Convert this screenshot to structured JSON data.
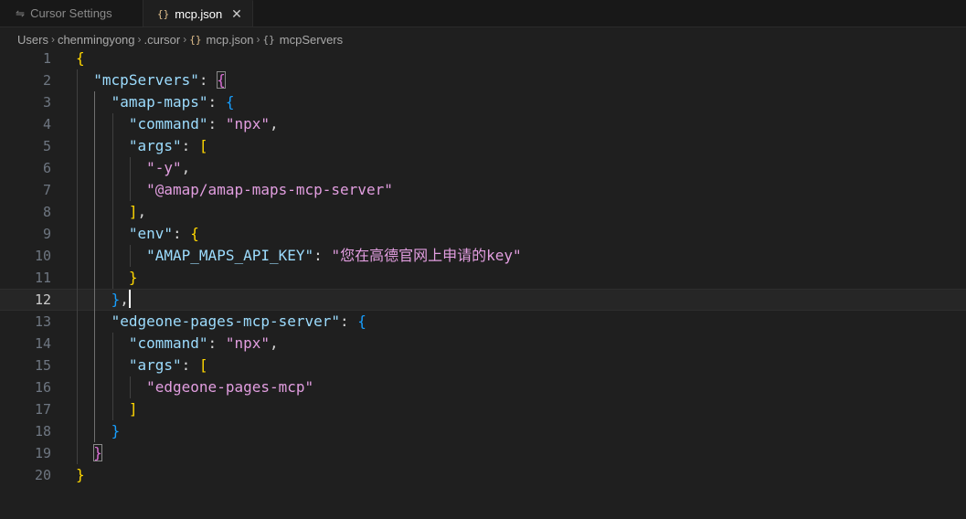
{
  "tabs": [
    {
      "label": "Cursor Settings",
      "icon": "settings-sliders-icon",
      "active": false
    },
    {
      "label": "mcp.json",
      "icon": "json-braces-icon",
      "active": true
    }
  ],
  "breadcrumb": [
    "Users",
    "chenmingyong",
    ".cursor",
    "mcp.json",
    "mcpServers"
  ],
  "editor": {
    "current_line": 12,
    "lines": [
      "{",
      "  \"mcpServers\": {",
      "    \"amap-maps\": {",
      "      \"command\": \"npx\",",
      "      \"args\": [",
      "        \"-y\",",
      "        \"@amap/amap-maps-mcp-server\"",
      "      ],",
      "      \"env\": {",
      "        \"AMAP_MAPS_API_KEY\": \"您在高德官网上申请的key\"",
      "      }",
      "    },",
      "    \"edgeone-pages-mcp-server\": {",
      "      \"command\": \"npx\",",
      "      \"args\": [",
      "        \"edgeone-pages-mcp\"",
      "      ]",
      "    }",
      "  }",
      "}"
    ]
  },
  "colors": {
    "background": "#1f1f1f",
    "key": "#9cdcfe",
    "string": "#e29ee0",
    "bracket_level1": "#ffd700",
    "bracket_level2": "#da70d6",
    "bracket_level3": "#179fff"
  }
}
